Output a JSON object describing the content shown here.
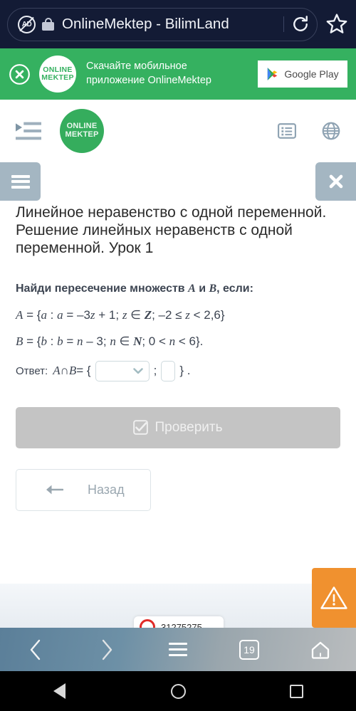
{
  "browser": {
    "omnibox": {
      "title": "OnlineMektep - BilimLand",
      "adblock_label": "AD",
      "adblock_icon": "adblock-icon",
      "lock_icon": "lock-icon",
      "reload_icon": "reload-icon",
      "star_icon": "star-bookmark-icon"
    },
    "bottom_nav": {
      "back_icon": "chevron-left-icon",
      "forward_icon": "chevron-right-icon",
      "menu_icon": "hamburger-menu-icon",
      "tab_count": "19",
      "home_icon": "home-icon"
    }
  },
  "android": {
    "back_icon": "android-back-triangle-icon",
    "home_icon": "android-home-circle-icon",
    "recents_icon": "android-recents-square-icon"
  },
  "promo": {
    "close_icon": "close-circle-icon",
    "logo_line1": "ONLINE",
    "logo_line2": "MEKTEP",
    "text_line1": "Скачайте мобильное",
    "text_line2": "приложение OnlineMektep",
    "store_label": "Google Play",
    "store_icon": "google-play-icon",
    "bg_color": "#35b160"
  },
  "site_header": {
    "expand_icon": "expand-sidebar-icon",
    "logo_line1": "ONLINE",
    "logo_line2": "MEKTEP",
    "contents_icon": "contents-list-icon",
    "language_icon": "globe-language-icon",
    "logo_color": "#35ad5d"
  },
  "action_row": {
    "menu_icon": "hamburger-menu-icon",
    "close_icon": "close-x-icon",
    "button_color": "#a4b6c2"
  },
  "lesson": {
    "title": "Линейное неравенство с одной переменной. Решение линейных неравенств с одной переменной. Урок 1"
  },
  "task": {
    "question_prefix": "Найди пересечение множеств ",
    "question_set_a": "A",
    "question_conj": " и ",
    "question_set_b": "B",
    "question_suffix": ", если:",
    "set_a": {
      "name": "A",
      "eq": " = {",
      "var": "a",
      "colon": " : ",
      "var2": "a",
      "body": " = –3",
      "z1": "z",
      "body2": " + 1; ",
      "z2": "z",
      "in": " ∈ ",
      "domain": "Z",
      "range": "; –2 ≤ ",
      "z3": "z",
      "range2": " < 2,6}"
    },
    "set_b": {
      "name": "B",
      "eq": " = {",
      "var": "b",
      "colon": " : ",
      "var2": "b",
      "body": " = ",
      "n1": "n",
      "body2": " – 3; ",
      "n2": "n",
      "in": " ∈ ",
      "domain": "N",
      "range": "; 0 < ",
      "n3": "n",
      "range2": " < 6}."
    },
    "answer": {
      "label": "Ответ:",
      "expr_a": "A",
      "cap": " ∩ ",
      "expr_b": "B",
      "equals": " = {",
      "select_value": "",
      "select_icon": "chevron-down-icon",
      "separator": ";",
      "input_value": "",
      "closing": "} ."
    }
  },
  "buttons": {
    "check_label": "Проверить",
    "check_icon": "checkbox-checked-icon",
    "check_color": "#c4c4c4",
    "back_label": "Назад",
    "back_icon": "arrow-left-icon"
  },
  "footer": {
    "warning_icon": "warning-triangle-icon",
    "warning_color": "#f0912f",
    "task_id": "31275275",
    "record_icon": "record-circle-icon"
  }
}
